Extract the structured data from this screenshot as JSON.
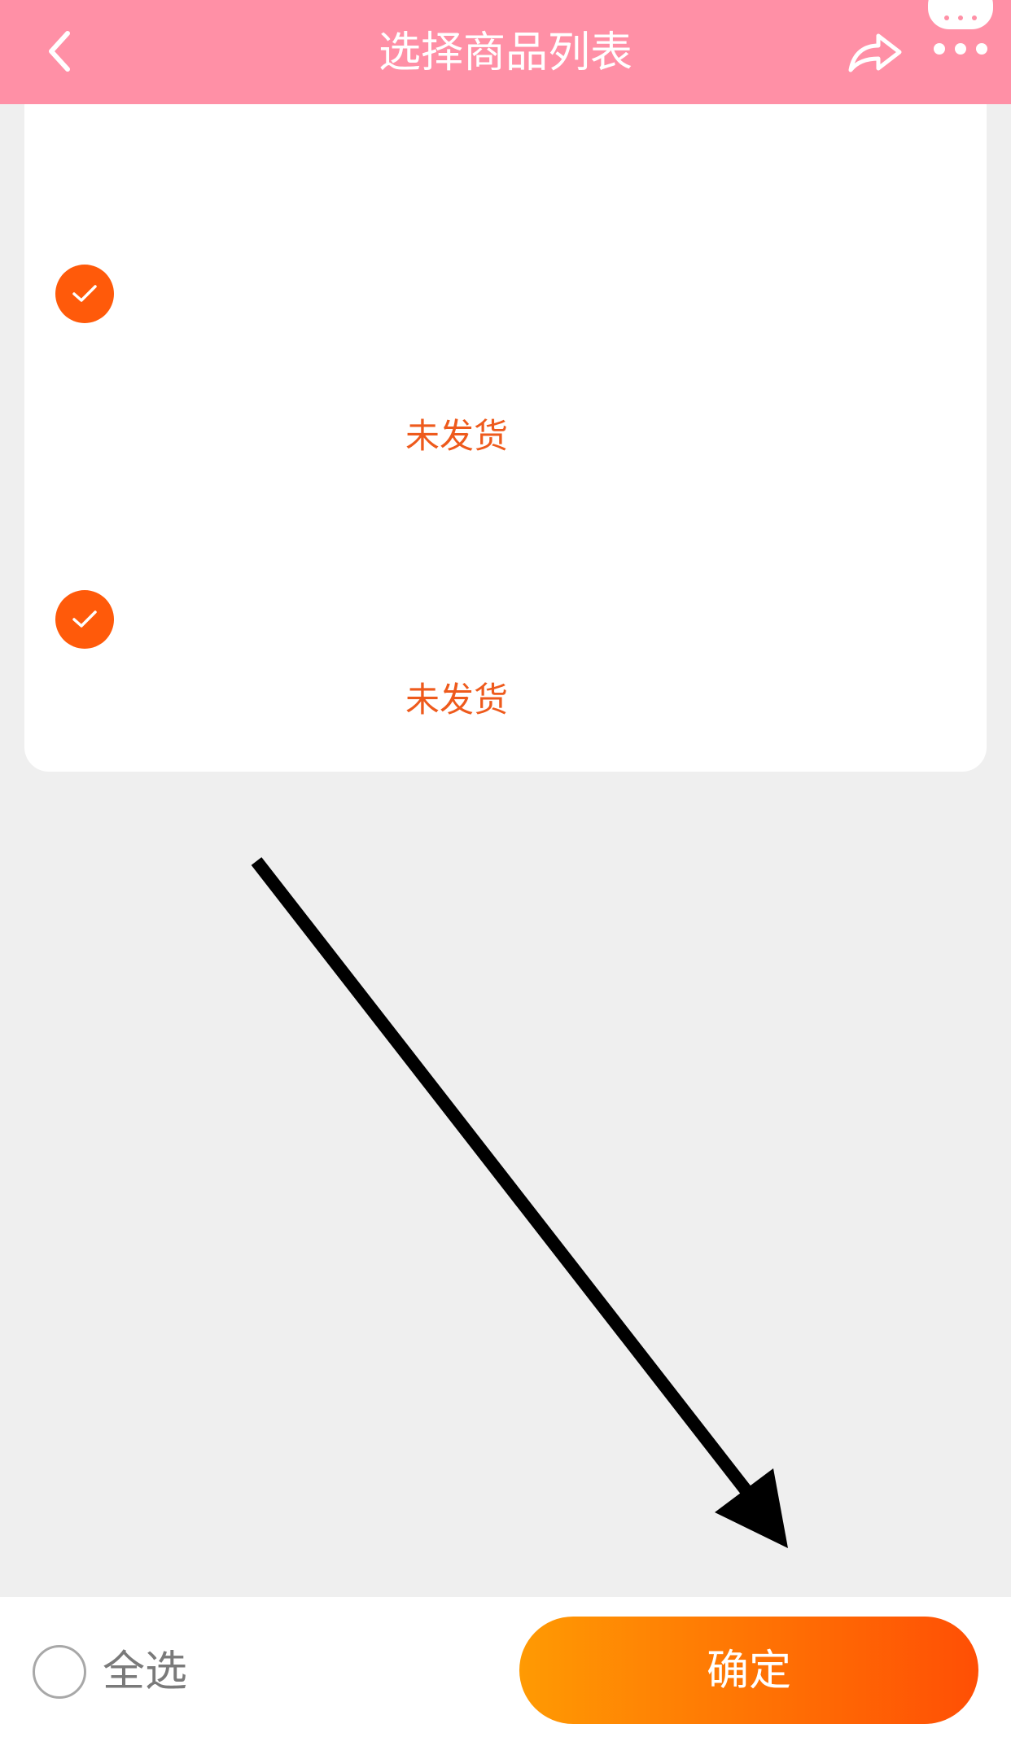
{
  "header": {
    "title": "选择商品列表",
    "back_icon": "chevron-left-icon",
    "share_icon": "share-arrow-icon",
    "more_icon": "more-dots-icon",
    "background": "#ff90a6"
  },
  "items": [
    {
      "checked": true,
      "status": "未发货"
    },
    {
      "checked": true,
      "status": "未发货"
    }
  ],
  "footer": {
    "select_all_label": "全选",
    "confirm_label": "确定"
  },
  "colors": {
    "accent": "#ff5a0a",
    "status_text": "#ee5a1c",
    "button_gradient_start": "#ff9a03",
    "button_gradient_end": "#ff4f05"
  }
}
